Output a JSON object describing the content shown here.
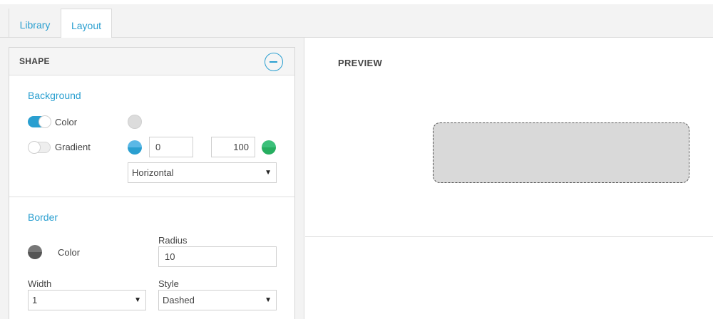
{
  "tabs": {
    "library": "Library",
    "layout": "Layout"
  },
  "shape_panel": {
    "title": "SHAPE",
    "background": {
      "section_title": "Background",
      "color_toggle": {
        "label": "Color",
        "state": "on"
      },
      "gradient_toggle": {
        "label": "Gradient",
        "state": "off"
      },
      "gradient_start": "0",
      "gradient_end": "100",
      "gradient_direction": "Horizontal"
    },
    "border": {
      "section_title": "Border",
      "color_label": "Color",
      "radius_label": "Radius",
      "radius_value": "10",
      "width_label": "Width",
      "width_value": "1",
      "style_label": "Style",
      "style_value": "Dashed"
    }
  },
  "preview": {
    "title": "PREVIEW"
  },
  "colors": {
    "accent": "#2a9fd0",
    "background_color": "#dcdcdc",
    "gradient_start_color": "#2a9fd0",
    "gradient_end_color": "#27ae60",
    "border_color": "#555555",
    "preview_fill": "#d9d9d9"
  }
}
